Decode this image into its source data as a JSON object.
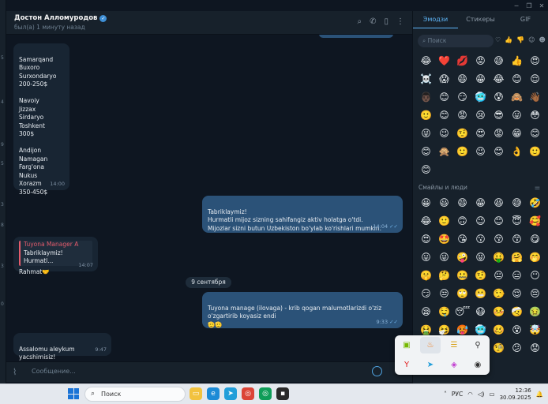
{
  "chat": {
    "name": "Достон Алломуродов",
    "status": "был(а) 1 минуту назад",
    "composer_placeholder": "Сообщение..."
  },
  "messages": [
    {
      "dir": "in",
      "text": "Samarqand\nBuxoro\nSurxondaryo\n200-250$\n\nNavoiy\nJizzax\nSirdaryo\nToshkent\n300$\n\nAndijon\nNamagan\nFarg'ona\nNukus\nXorazm\n350-450$",
      "time": "14:00"
    },
    {
      "dir": "out",
      "text": "Tabriklaymiz!\nHurmatli mijoz sizning sahifangiz aktiv holatga o'tdi.\nMijozlar sizni butun Uzbekiston bo'ylab ko'rishlari mumkin.",
      "time": "14:04"
    },
    {
      "dir": "in",
      "reply_name": "Tuyona Manager A",
      "reply_text": "Tabriklaymiz!  Hurmatl...",
      "text": "Rahmat🤝",
      "time": "14:07"
    },
    {
      "dir": "out",
      "text": "Tuyona manage (ilovaga) - krib qogan malumotlarizdi o'ziz\no'zgartirib koyasiz endi\n🫡🫡",
      "time": "9:33"
    },
    {
      "dir": "in",
      "text": "Assalomu aleykum yacshimisiz!\nHop bo'ladi",
      "time": "9:47"
    }
  ],
  "date_separator": "9 сентября",
  "emoji_panel": {
    "tabs": [
      "Эмодзи",
      "Стикеры",
      "GIF"
    ],
    "search_placeholder": "Поиск",
    "section_title": "Смайлы и люди",
    "recent": [
      "😂",
      "❤️",
      "💋",
      "😡",
      "😅",
      "👍",
      "😍",
      "☠️",
      "😱",
      "😄",
      "😁",
      "😂",
      "😊",
      "😌",
      "👨🏿",
      "😊",
      "😏",
      "🥶",
      "😰",
      "🙈",
      "👋🏾",
      "🙂",
      "😊",
      "😡",
      "😢",
      "😎",
      "😛",
      "😳",
      "😜",
      "😉",
      "🤨",
      "😍",
      "😡",
      "😁",
      "😊",
      "😊",
      "🙊",
      "🙂",
      "😉",
      "😊",
      "👌",
      "🙂",
      "😊"
    ],
    "smileys": [
      "😀",
      "😃",
      "😄",
      "😁",
      "😆",
      "😅",
      "🤣",
      "😂",
      "🙂",
      "🙃",
      "😉",
      "😊",
      "😇",
      "🥰",
      "😍",
      "🤩",
      "😘",
      "😗",
      "😚",
      "😙",
      "😋",
      "😛",
      "😜",
      "🤪",
      "😝",
      "🤑",
      "🤗",
      "🤭",
      "🤫",
      "🤔",
      "🤐",
      "🤨",
      "😐",
      "😑",
      "😶",
      "😏",
      "😒",
      "🙄",
      "😬",
      "🤥",
      "😌",
      "😔",
      "😪",
      "🤤",
      "😴",
      "😷",
      "🤒",
      "🤕",
      "🤢",
      "🤮",
      "🤧",
      "🥵",
      "🥶",
      "🥴",
      "😵",
      "🤯",
      "🤠",
      "🥳",
      "😎",
      "🤓",
      "🧐",
      "😕",
      "😟"
    ]
  },
  "taskbar": {
    "search_placeholder": "Поиск",
    "language": "РУС",
    "time": "12:36",
    "date": "30.09.2025"
  }
}
